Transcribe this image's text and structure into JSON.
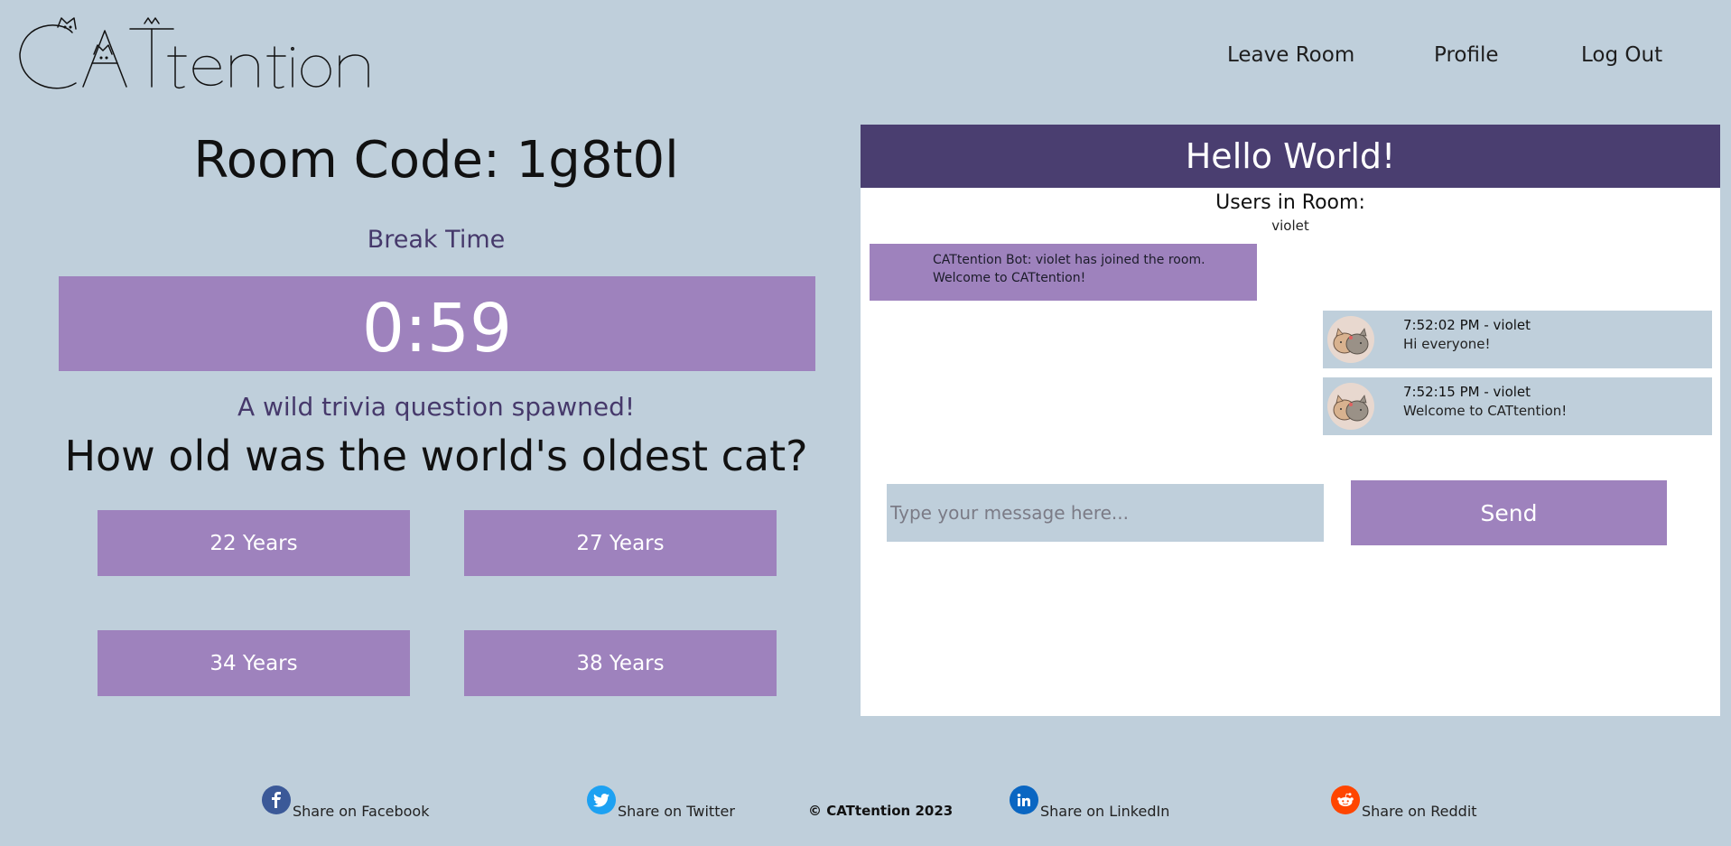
{
  "brand": {
    "logo_text": "CATtention"
  },
  "nav": {
    "leave_room": "Leave Room",
    "profile": "Profile",
    "log_out": "Log Out"
  },
  "room": {
    "code_label": "Room Code: 1g8t0l",
    "status": "Break Time",
    "timer": "0:59"
  },
  "trivia": {
    "spawn_text": "A wild trivia question spawned!",
    "question": "How old was the world's oldest cat?",
    "answers": [
      "22 Years",
      "27 Years",
      "34 Years",
      "38 Years"
    ]
  },
  "chat": {
    "title": "Hello World!",
    "users_title": "Users in Room:",
    "users": "violet",
    "bot_message": "CATtention  Bot: violet has joined the room. Welcome to CATtention!",
    "messages": [
      {
        "meta": "7:52:02  PM - violet",
        "text": "Hi everyone!"
      },
      {
        "meta": "7:52:15  PM - violet",
        "text": "Welcome to CATtention!"
      }
    ],
    "input_placeholder": "Type your message here...",
    "send_label": "Send"
  },
  "footer": {
    "facebook": "Share on  Facebook",
    "twitter": "Share on Twitter",
    "copyright": "© CATtention 2023",
    "linkedin": "Share on  LinkedIn",
    "reddit": "Share on  Reddit"
  },
  "colors": {
    "background": "#bfcfdb",
    "accent_purple": "#9e82bd",
    "header_purple": "#4a3e70",
    "facebook": "#3b5998",
    "twitter": "#1da1f2",
    "linkedin": "#0a66c2",
    "reddit": "#ff4500"
  },
  "icons": [
    "facebook-icon",
    "twitter-icon",
    "linkedin-icon",
    "reddit-icon"
  ]
}
